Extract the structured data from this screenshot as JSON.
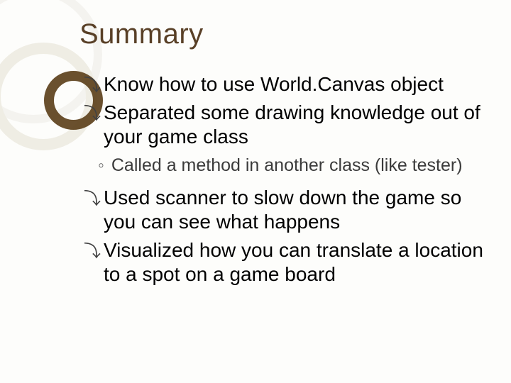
{
  "title": "Summary",
  "bullets": {
    "b1": "Know how to use World.Canvas object",
    "b2": "Separated some drawing knowledge out of your game class",
    "b2_sub": "Called a method in another class (like tester)",
    "b3": "Used scanner to slow down the game so you can see what happens",
    "b4": "Visualized how you can translate a location to a spot on a game board"
  },
  "glyphs": {
    "main": "",
    "main_fallback": "⤵",
    "sub": "◦"
  }
}
